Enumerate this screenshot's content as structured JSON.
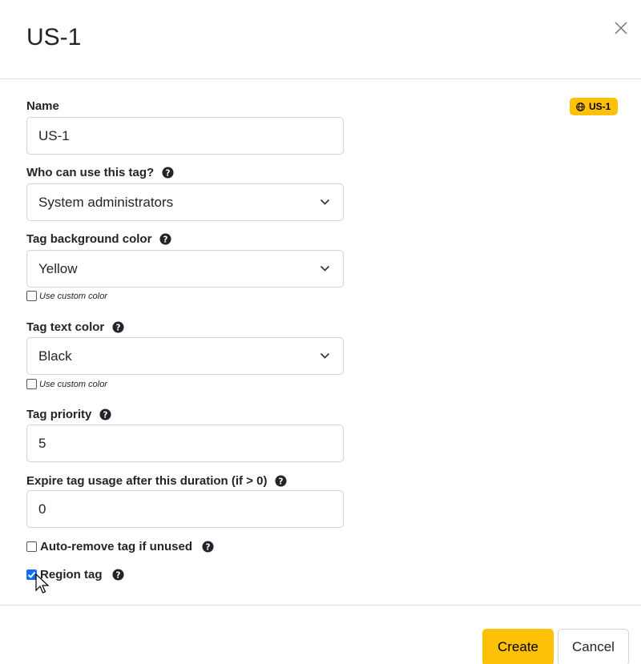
{
  "header": {
    "title": "US-1"
  },
  "preview": {
    "label": "US-1",
    "icon": "globe-icon",
    "bg_color": "#ffc107"
  },
  "form": {
    "name": {
      "label": "Name",
      "value": "US-1"
    },
    "who": {
      "label": "Who can use this tag?",
      "value": "System administrators"
    },
    "bg_color": {
      "label": "Tag background color",
      "value": "Yellow",
      "custom_label": "Use custom color"
    },
    "text_color": {
      "label": "Tag text color",
      "value": "Black",
      "custom_label": "Use custom color"
    },
    "priority": {
      "label": "Tag priority",
      "value": "5"
    },
    "expire": {
      "label": "Expire tag usage after this duration (if > 0)",
      "value": "0"
    },
    "auto_remove": {
      "label": "Auto-remove tag if unused",
      "checked": false
    },
    "region": {
      "label": "Region tag",
      "checked": true
    }
  },
  "footer": {
    "create_label": "Create",
    "cancel_label": "Cancel"
  }
}
